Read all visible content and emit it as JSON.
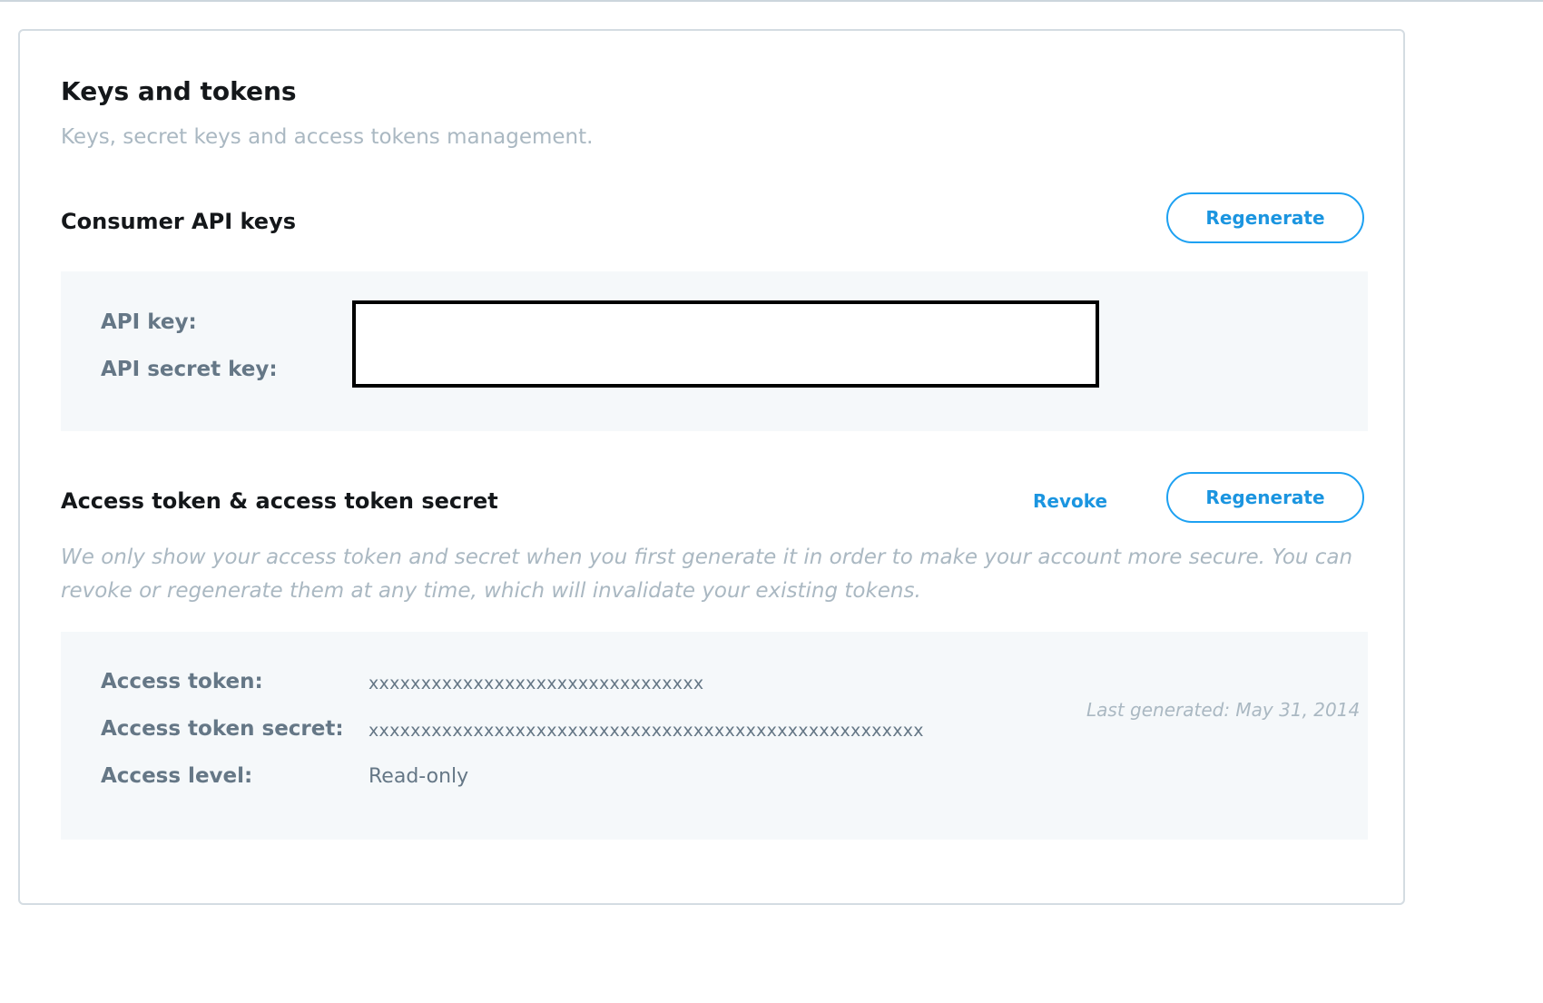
{
  "header": {
    "title": "Keys and tokens",
    "subtitle": "Keys, secret keys and access tokens management."
  },
  "consumer": {
    "title": "Consumer API keys",
    "regenerate_label": "Regenerate",
    "fields": [
      {
        "label": "API key:",
        "value": ""
      },
      {
        "label": "API secret key:",
        "value": ""
      }
    ]
  },
  "access": {
    "title": "Access token & access token secret",
    "revoke_label": "Revoke",
    "regenerate_label": "Regenerate",
    "help_text": "We only show your access token and secret when you first generate it in order to make your account more secure. You can revoke or regenerate them at any time, which will invalidate your existing tokens.",
    "fields": [
      {
        "label": "Access token:",
        "value": "xxxxxxxxxxxxxxxxxxxxxxxxxxxxxxxx"
      },
      {
        "label": "Access token secret:",
        "value": "xxxxxxxxxxxxxxxxxxxxxxxxxxxxxxxxxxxxxxxxxxxxxxxxxxxxx"
      },
      {
        "label": "Access level:",
        "value": "Read-only"
      }
    ],
    "last_generated": "Last generated: May 31, 2014"
  },
  "colors": {
    "accent": "#1da1f2",
    "panel_bg": "#f5f8fa",
    "muted_text": "#aab8c2",
    "label_text": "#657786"
  }
}
